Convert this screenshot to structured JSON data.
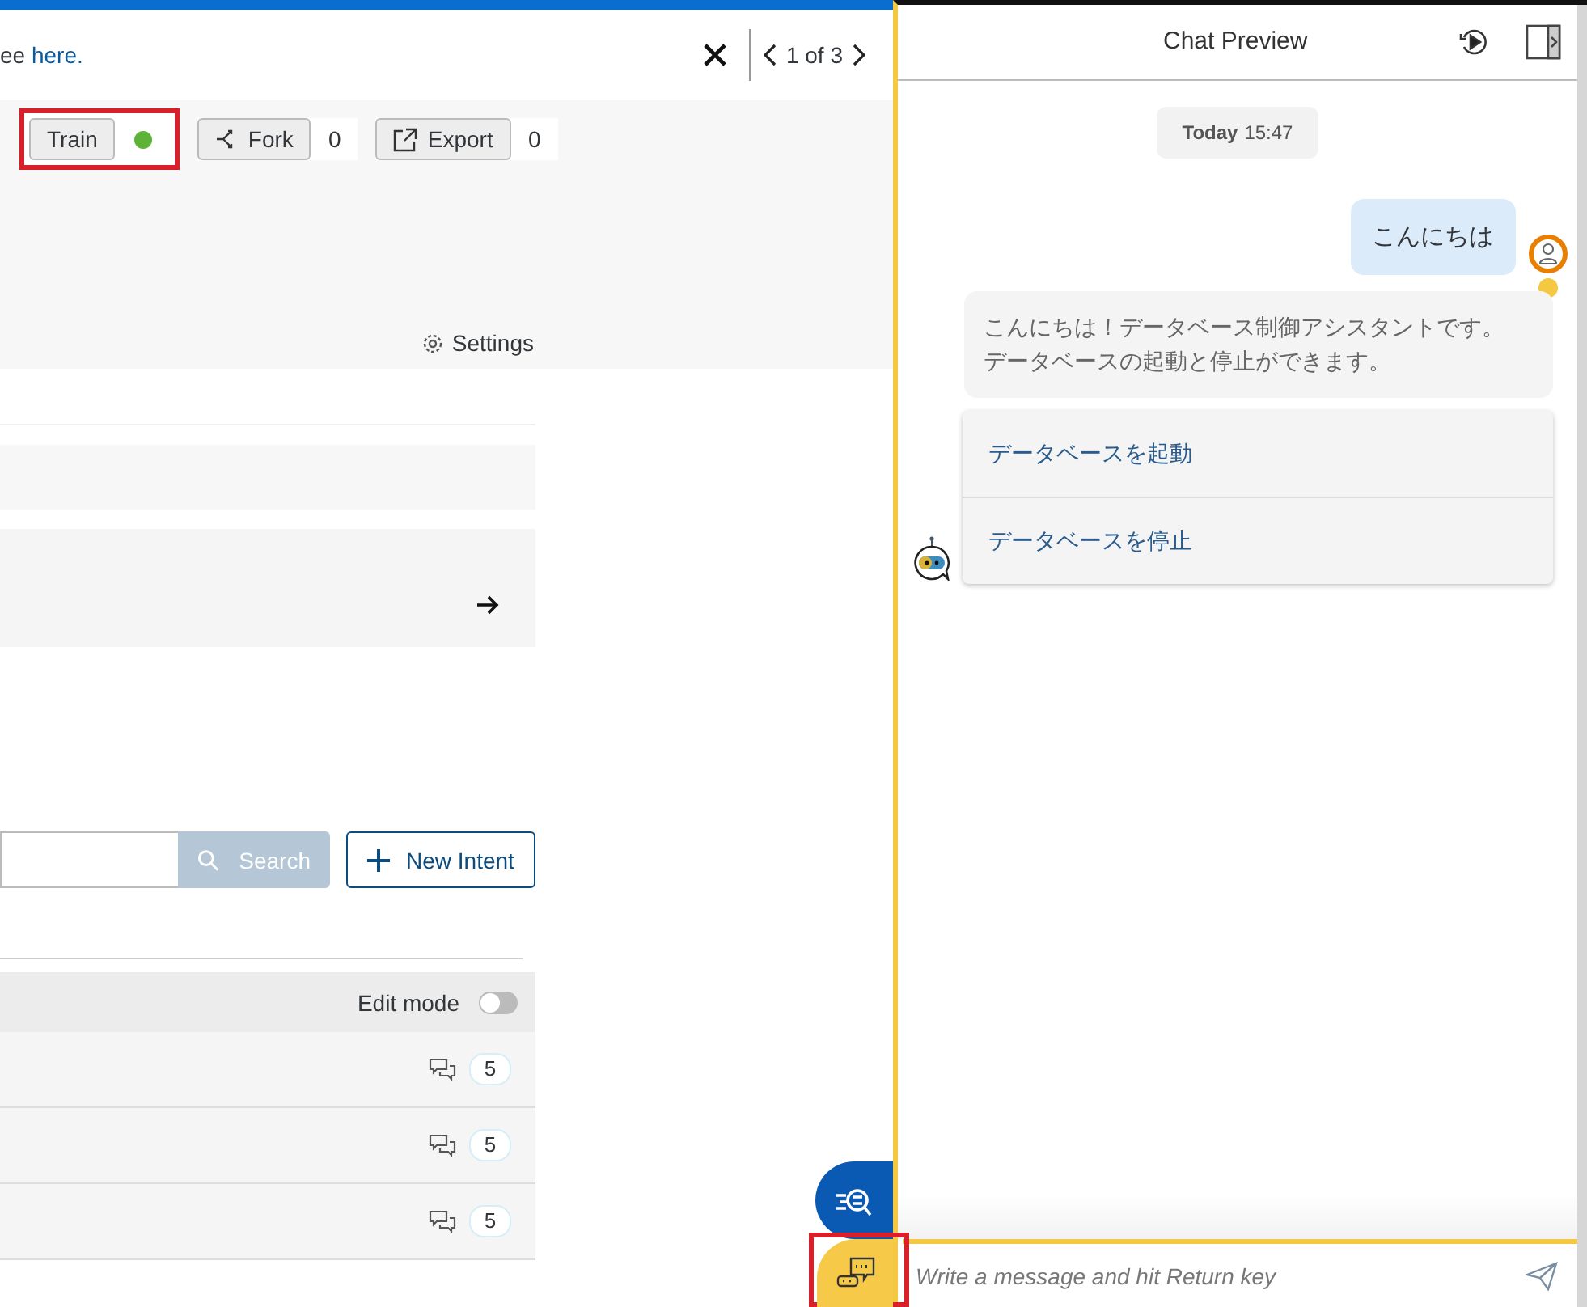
{
  "notice": {
    "text": "ee",
    "link": "here."
  },
  "pager": {
    "label": "1 of 3"
  },
  "toolbar": {
    "train": {
      "label": "Train",
      "highlighted": true,
      "color": "#5cb338"
    },
    "actions": [
      {
        "kind": "fork",
        "label": "Fork",
        "count": "0"
      },
      {
        "kind": "export",
        "label": "Export",
        "count": "0"
      }
    ]
  },
  "settings": {
    "label": "Settings"
  },
  "search": {
    "button": "Search"
  },
  "new_intent": {
    "label": "New Intent"
  },
  "table": {
    "edit_mode": {
      "label": "Edit mode",
      "on": false
    },
    "rows": [
      {
        "count": "5"
      },
      {
        "count": "5"
      },
      {
        "count": "5"
      }
    ]
  },
  "launcher": {
    "highlighted": true
  },
  "chat": {
    "title": "Chat Preview",
    "date": {
      "day": "Today",
      "time": "15:47"
    },
    "messages": [
      {
        "kind": "user",
        "text": "こんにちは"
      },
      {
        "kind": "bot",
        "text": "こんにちは！データベース制御アシスタントです。データベースの起動と停止ができます。"
      }
    ],
    "quick_replies": [
      "データベースを起動",
      "データベースを停止"
    ],
    "input": {
      "placeholder": "Write a message and hit Return key"
    }
  }
}
